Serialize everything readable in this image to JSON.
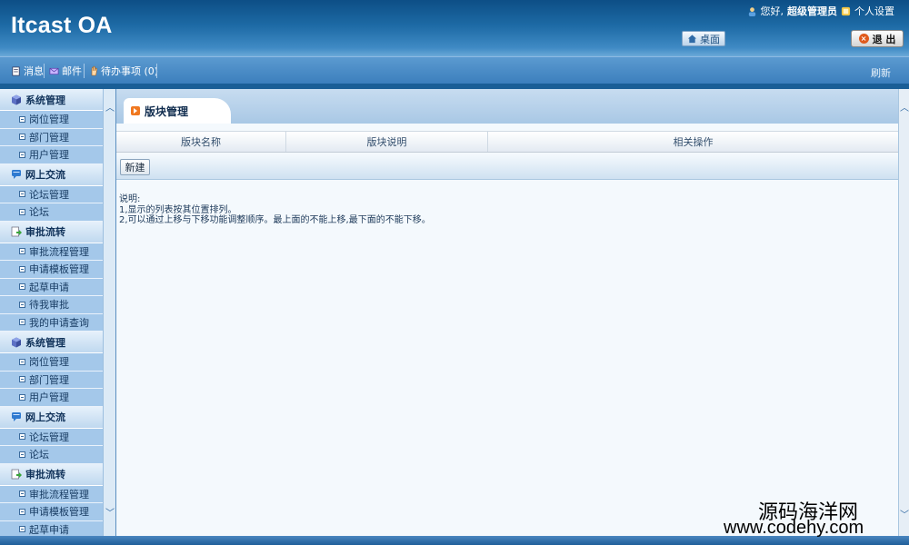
{
  "header": {
    "logo": "Itcast OA",
    "greeting": "您好,",
    "username": "超级管理员",
    "settings": "个人设置",
    "desktop": "桌面",
    "logout": "退 出"
  },
  "toolbar": {
    "messages": "消息",
    "mail": "邮件",
    "todo": "待办事项 (0)",
    "refresh": "刷新"
  },
  "sidebar": {
    "groups": [
      {
        "title": "系统管理",
        "icon": "system-cube-icon",
        "items": [
          "岗位管理",
          "部门管理",
          "用户管理"
        ]
      },
      {
        "title": "网上交流",
        "icon": "chat-icon",
        "items": [
          "论坛管理",
          "论坛"
        ]
      },
      {
        "title": "审批流转",
        "icon": "approval-doc-icon",
        "items": [
          "审批流程管理",
          "申请模板管理",
          "起草申请",
          "待我审批",
          "我的申请查询"
        ]
      },
      {
        "title": "系统管理",
        "icon": "system-cube-icon",
        "items": [
          "岗位管理",
          "部门管理",
          "用户管理"
        ]
      },
      {
        "title": "网上交流",
        "icon": "chat-icon",
        "items": [
          "论坛管理",
          "论坛"
        ]
      },
      {
        "title": "审批流转",
        "icon": "approval-doc-icon",
        "items": [
          "审批流程管理",
          "申请模板管理",
          "起草申请"
        ]
      }
    ]
  },
  "main": {
    "tab_title": "版块管理",
    "columns": [
      "版块名称",
      "版块说明",
      "相关操作"
    ],
    "new_button": "新建",
    "notes": [
      "说明:",
      "1,显示的列表按其位置排列。",
      "2,可以通过上移与下移功能调整顺序。最上面的不能上移,最下面的不能下移。"
    ]
  },
  "watermark": {
    "line1": "源码海洋网",
    "line2": "www.codehy.com"
  },
  "colors": {
    "header_dark": "#0d4e86",
    "toolbar": "#4a8cc7",
    "sidebar_item": "#a4c8ea",
    "accent_orange": "#f07820"
  }
}
